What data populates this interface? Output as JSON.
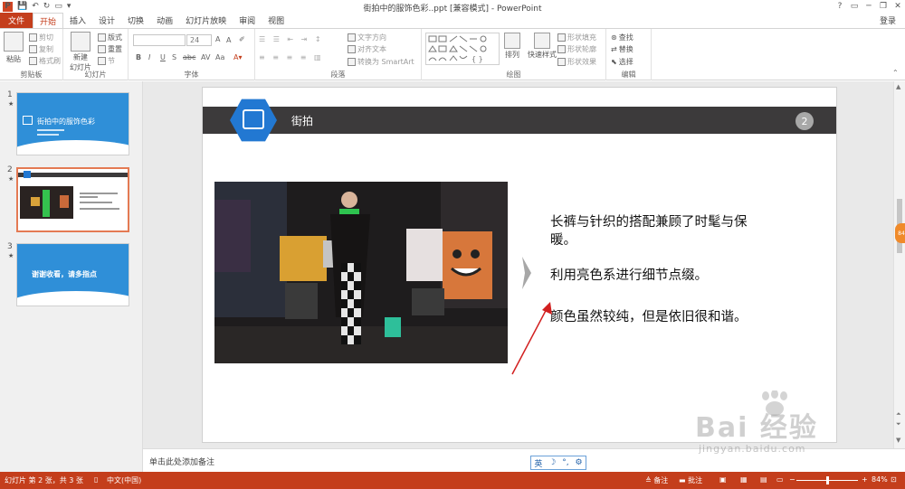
{
  "window": {
    "title": "街拍中的服饰色彩..ppt [兼容模式] - PowerPoint",
    "controls": [
      "?",
      "▭",
      "─",
      "❐",
      "✕"
    ]
  },
  "tabs": {
    "file": "文件",
    "items": [
      "开始",
      "插入",
      "设计",
      "切换",
      "动画",
      "幻灯片放映",
      "审阅",
      "视图"
    ],
    "active": "开始",
    "login": "登录"
  },
  "ribbon": {
    "clipboard": {
      "label": "剪贴板",
      "paste": "粘贴",
      "cut": "剪切",
      "copy": "复制",
      "format_painter": "格式刷"
    },
    "slides": {
      "label": "幻灯片",
      "new_slide": "新建",
      "new_slide2": "幻灯片",
      "layout": "版式",
      "reset": "重置",
      "section": "节"
    },
    "font": {
      "label": "字体",
      "size": "24",
      "buttons": [
        "B",
        "I",
        "U",
        "S",
        "abc",
        "AV",
        "Aa",
        "A",
        "A"
      ]
    },
    "paragraph": {
      "label": "段落",
      "text_direction": "文字方向",
      "align_text": "对齐文本",
      "smartart": "转换为 SmartArt"
    },
    "drawing": {
      "label": "绘图",
      "arrange": "排列",
      "quick_styles": "快速样式",
      "shape_fill": "形状填充",
      "shape_outline": "形状轮廓",
      "shape_effects": "形状效果"
    },
    "editing": {
      "label": "编辑",
      "find": "查找",
      "replace": "替换",
      "select": "选择"
    }
  },
  "thumbnails": [
    {
      "num": "1",
      "star": "★",
      "title": "街拍中的服饰色彩"
    },
    {
      "num": "2",
      "star": "★",
      "selected": true
    },
    {
      "num": "3",
      "star": "★",
      "title": "谢谢收看，请多指点"
    }
  ],
  "slide": {
    "header": "街拍",
    "page_number": "2",
    "lines": [
      "长裤与针织的搭配兼顾了时髦与保",
      "暖。",
      "利用亮色系进行细节点缀。",
      "颜色虽然较纯，但是依旧很和谐。"
    ],
    "accent": "#2278d2",
    "bar_color": "#3c3a3b"
  },
  "notes": {
    "placeholder": "单击此处添加备注",
    "ime": [
      "英",
      "☽",
      "°,",
      "⚙"
    ]
  },
  "status": {
    "slide_info": "幻灯片 第 2 张，共 3 张",
    "language": "中文(中国)",
    "notes": "备注",
    "comments": "批注",
    "zoom_minus": "−",
    "zoom_plus": "+",
    "zoom": "84%",
    "zoom_level": 0.5
  },
  "watermark": {
    "brand": "Bai  经验",
    "url": "jingyan.baidu.com"
  },
  "side_badge": "84"
}
